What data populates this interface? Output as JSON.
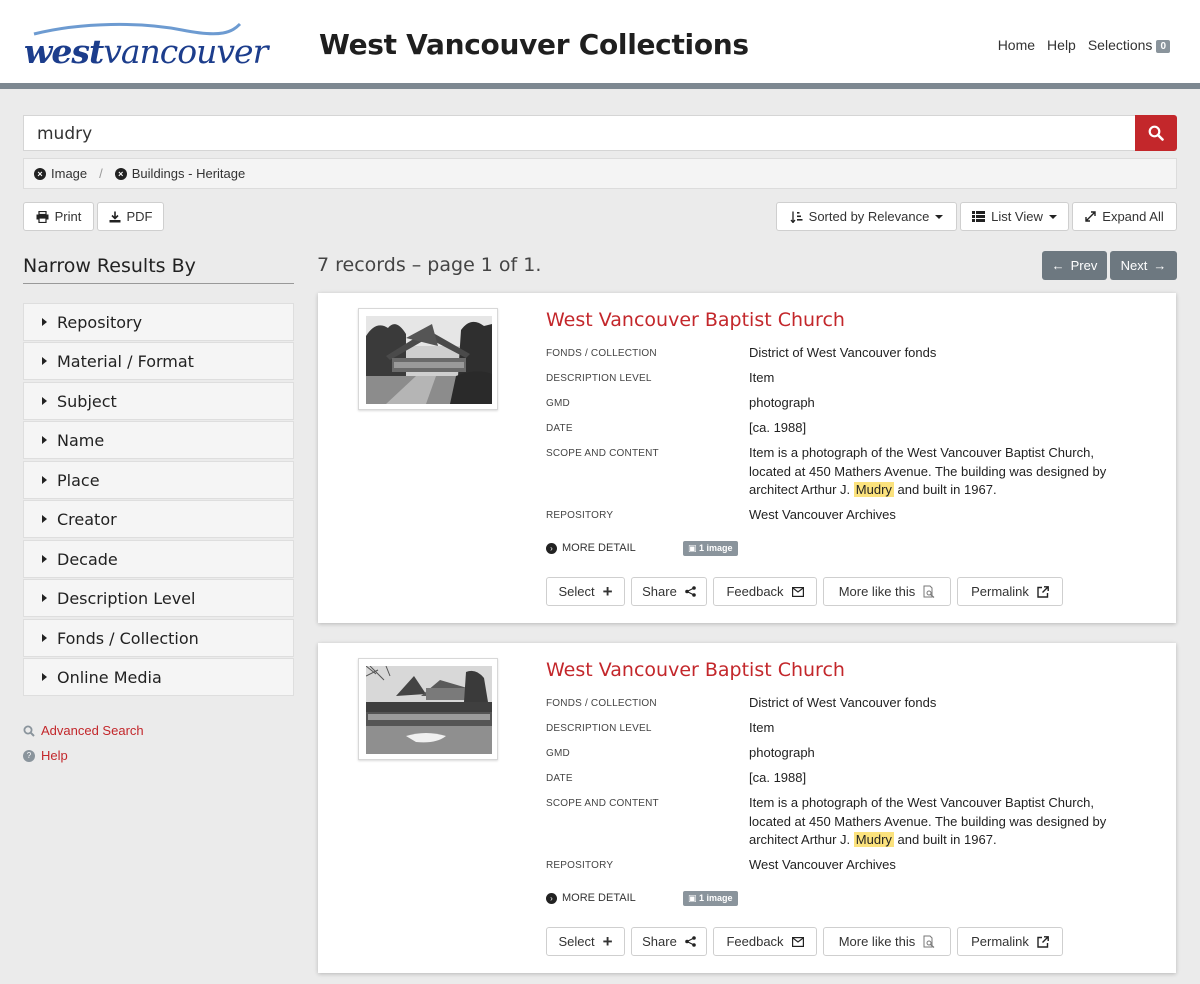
{
  "site": {
    "logo_word_west": "west",
    "logo_word_vancouver": "vancouver",
    "title": "West Vancouver Collections",
    "nav": {
      "home": "Home",
      "help": "Help",
      "selections": "Selections",
      "selections_count": "0"
    }
  },
  "search": {
    "query": "mudry"
  },
  "filters": [
    {
      "label": "Image"
    },
    {
      "label": "Buildings - Heritage"
    }
  ],
  "filter_separator": "/",
  "toolbar": {
    "print": "Print",
    "pdf": "PDF",
    "sort": "Sorted by Relevance",
    "view": "List View",
    "expand": "Expand All"
  },
  "sidebar": {
    "title": "Narrow Results By",
    "facets": [
      "Repository",
      "Material / Format",
      "Subject",
      "Name",
      "Place",
      "Creator",
      "Decade",
      "Description Level",
      "Fonds / Collection",
      "Online Media"
    ],
    "advanced_search": "Advanced Search",
    "help": "Help"
  },
  "results": {
    "summary": "7 records – page 1 of 1.",
    "prev": "Prev",
    "next": "Next"
  },
  "labels": {
    "fonds": "FONDS / COLLECTION",
    "level": "DESCRIPTION LEVEL",
    "gmd": "GMD",
    "date": "DATE",
    "scope": "SCOPE AND CONTENT",
    "repository": "REPOSITORY",
    "more_detail": "MORE DETAIL"
  },
  "actions": {
    "select": "Select",
    "share": "Share",
    "feedback": "Feedback",
    "more_like": "More like this",
    "permalink": "Permalink"
  },
  "records": [
    {
      "title": "West Vancouver Baptist Church",
      "fonds": "District of West Vancouver fonds",
      "level": "Item",
      "gmd": "photograph",
      "date": "[ca. 1988]",
      "scope_line1": "Item is a photograph of the West Vancouver Baptist Church,",
      "scope_line2": "located at 450 Mathers Avenue. The building was designed by",
      "scope_line3_pre": "architect Arthur J.",
      "scope_highlight": "Mudry",
      "scope_line3_post": "and built in 1967.",
      "repository": "West Vancouver Archives",
      "image_badge": "1 image"
    },
    {
      "title": "West Vancouver Baptist Church",
      "fonds": "District of West Vancouver fonds",
      "level": "Item",
      "gmd": "photograph",
      "date": "[ca. 1988]",
      "scope_line1": "Item is a photograph of the West Vancouver Baptist Church,",
      "scope_line2": "located at 450 Mathers Avenue. The building was designed by",
      "scope_line3_pre": "architect Arthur J.",
      "scope_highlight": "Mudry",
      "scope_line3_post": "and built in 1967.",
      "repository": "West Vancouver Archives",
      "image_badge": "1 image"
    }
  ]
}
